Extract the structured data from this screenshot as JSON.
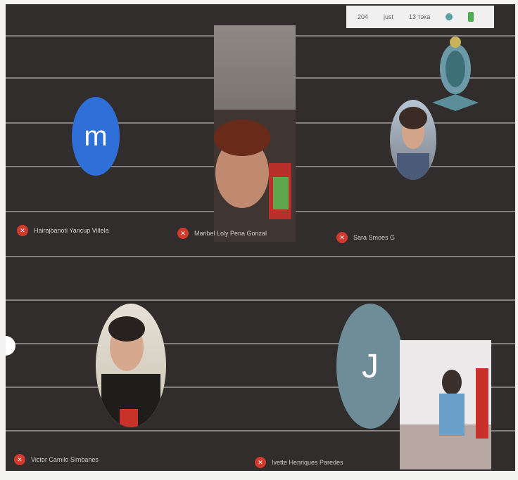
{
  "topbar": {
    "items": [
      "204",
      "just",
      "13 тэка"
    ]
  },
  "participants": [
    {
      "initial": "m",
      "name": "Hairajbanoti Yancup Villela",
      "avatar_color": "#2f6fd8"
    },
    {
      "name": "Maribel Loly Pena Gonzal"
    },
    {
      "name": "Sara Smoes G"
    },
    {
      "name": "Victor Camilo Simbanes"
    },
    {
      "initial": "J",
      "name": "Ivette Henriques Paredes",
      "avatar_color": "#6f8c99"
    }
  ],
  "icons": [
    "mic-off-icon",
    "emblem-icon"
  ],
  "colors": {
    "background": "#302d2c",
    "mic_off": "#d13a2d"
  }
}
